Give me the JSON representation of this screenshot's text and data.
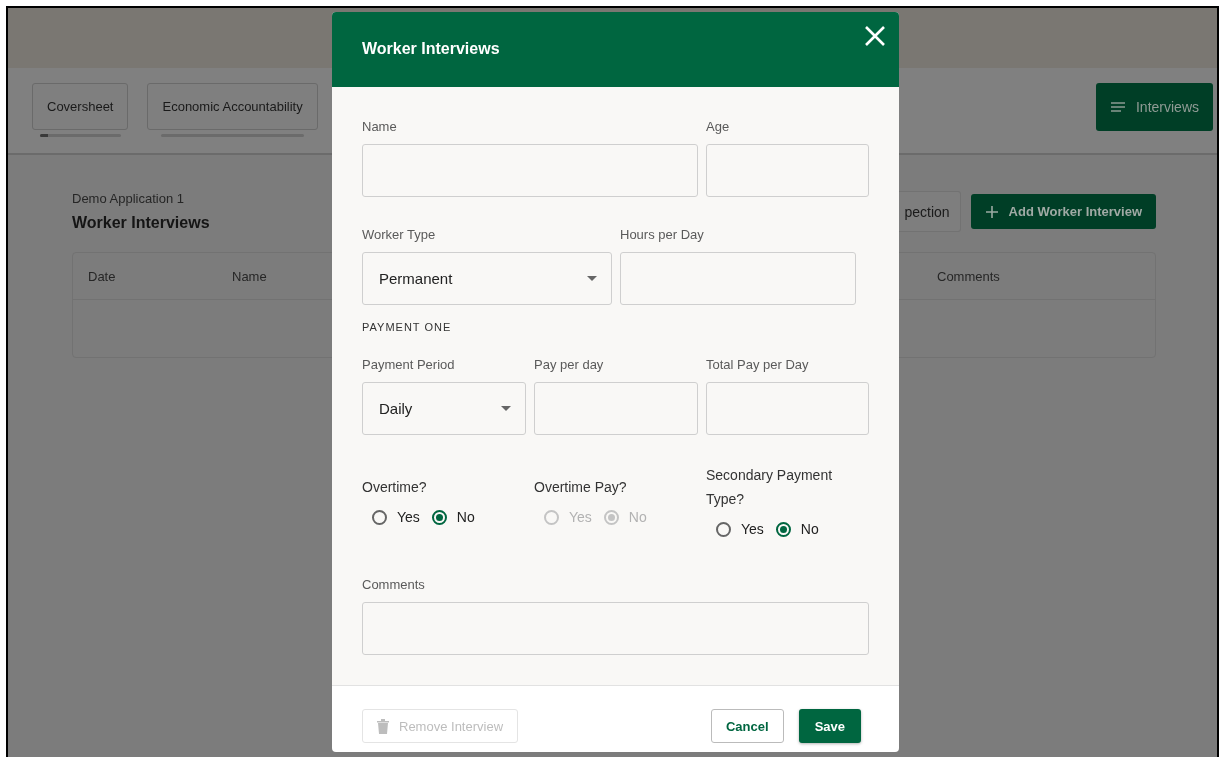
{
  "page": {
    "tabs": [
      {
        "label": "Coversheet",
        "level": 0.1
      },
      {
        "label": "Economic Accountability"
      }
    ],
    "menu_button": "Interviews",
    "breadcrumb": "Demo Application 1",
    "heading": "Worker Interviews",
    "inspection_button": "pection",
    "add_button": "Add Worker Interview",
    "table": {
      "columns": [
        "Date",
        "Name",
        "Comments"
      ]
    }
  },
  "dialog": {
    "title": "Worker Interviews",
    "rows": [
      {
        "kind": "fields",
        "fields": [
          {
            "kind": "text",
            "label": "Name"
          },
          {
            "kind": "text",
            "label": "Age"
          }
        ]
      },
      {
        "kind": "fields",
        "fields": [
          {
            "kind": "select",
            "label": "Worker Type",
            "value": "Permanent"
          },
          {
            "kind": "text",
            "label": "Hours per Day"
          }
        ]
      },
      {
        "kind": "section",
        "text": "PAYMENT ONE"
      },
      {
        "kind": "fields",
        "fields": [
          {
            "kind": "select",
            "label": "Payment Period",
            "value": "Daily"
          },
          {
            "kind": "text",
            "label": "Pay per day"
          },
          {
            "kind": "text",
            "label": "Total Pay per Day"
          }
        ]
      },
      {
        "kind": "radios",
        "groups": [
          {
            "label": "Overtime?",
            "disabled": false,
            "options": [
              {
                "label": "Yes",
                "selected": false
              },
              {
                "label": "No",
                "selected": true
              }
            ]
          },
          {
            "label": "Overtime Pay?",
            "disabled": true,
            "options": [
              {
                "label": "Yes",
                "selected": false
              },
              {
                "label": "No",
                "selected": true
              }
            ]
          },
          {
            "label": "Secondary Payment Type?",
            "disabled": false,
            "options": [
              {
                "label": "Yes",
                "selected": false
              },
              {
                "label": "No",
                "selected": true
              }
            ]
          }
        ]
      },
      {
        "kind": "fields",
        "fields": [
          {
            "kind": "textarea",
            "label": "Comments"
          }
        ]
      }
    ],
    "remove_button": {
      "label": "Remove Interview",
      "disabled": true
    },
    "cancel_button": "Cancel",
    "save_button": "Save"
  }
}
